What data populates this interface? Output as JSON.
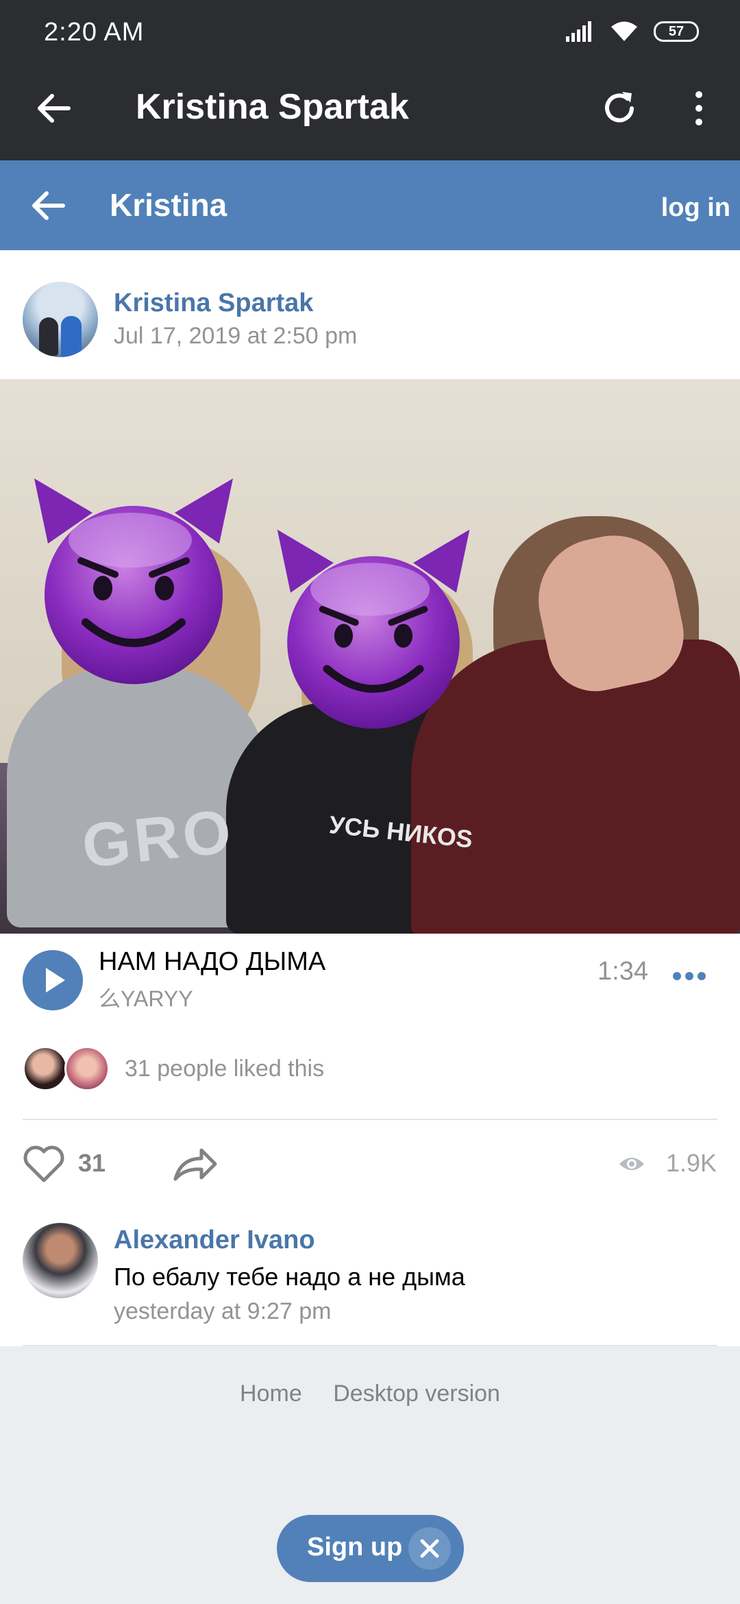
{
  "status_bar": {
    "time": "2:20  AM",
    "battery": "57"
  },
  "toolbar": {
    "title": "Kristina Spartak"
  },
  "vk_header": {
    "title": "Kristina",
    "login": "log in"
  },
  "post": {
    "author": "Kristina Spartak",
    "date": "Jul 17, 2019 at 2:50 pm",
    "photo_text_left": "GRO",
    "photo_text_shirt": "УСЬ НИКОS"
  },
  "audio": {
    "title": "НАМ НАДО ДЫМА",
    "artist": "么YARYY",
    "duration": "1:34"
  },
  "likes_summary": {
    "text": "31 people liked this"
  },
  "actions": {
    "likes": "31",
    "views": "1.9K"
  },
  "comment": {
    "author": "Alexander Ivano",
    "text": "По ебалу тебе надо а не дыма",
    "date": "yesterday at 9:27 pm"
  },
  "footer": {
    "links": [
      "Home",
      "Desktop version"
    ],
    "signup": "Sign up"
  },
  "colors": {
    "vk_blue": "#5181b8",
    "link_blue": "#4a76a8",
    "dark_bar": "#2b2d31"
  }
}
